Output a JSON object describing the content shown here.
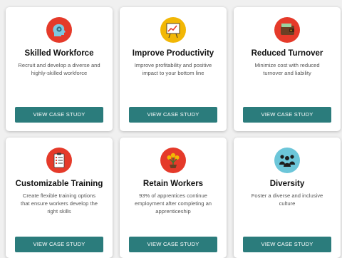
{
  "colors": {
    "button_bg": "#2b7c7c",
    "button_text": "#ffffff",
    "icon_red": "#e53a2a",
    "icon_yellow": "#f2b705",
    "icon_teal": "#6cc6d9",
    "title_text": "#111111",
    "desc_text": "#555555"
  },
  "cards": [
    {
      "icon": "head-gear-icon",
      "title": "Skilled Workforce",
      "desc_lines": [
        "Recruit and develop a diverse and",
        "highly-skilled workforce"
      ],
      "button_label": "VIEW CASE STUDY"
    },
    {
      "icon": "chart-board-icon",
      "title": "Improve Productivity",
      "desc_lines": [
        "Improve profitability and positive",
        "impact to your bottom line"
      ],
      "button_label": "VIEW CASE STUDY"
    },
    {
      "icon": "wallet-icon",
      "title": "Reduced Turnover",
      "desc_lines": [
        "Minimize cost with reduced",
        "turnover and liability"
      ],
      "button_label": "VIEW CASE STUDY"
    },
    {
      "icon": "clipboard-icon",
      "title": "Customizable Training",
      "desc_lines": [
        "Create flexible training options",
        "that ensure workers develop the",
        "right skills"
      ],
      "button_label": "VIEW CASE STUDY"
    },
    {
      "icon": "money-plant-icon",
      "title": "Retain Workers",
      "desc_lines": [
        "93% of apprentices continue",
        "employment after completing an",
        "apprenticeship"
      ],
      "button_label": "VIEW CASE STUDY"
    },
    {
      "icon": "people-group-icon",
      "title": "Diversity",
      "desc_lines": [
        "Foster a diverse and inclusive",
        "culture"
      ],
      "button_label": "VIEW CASE STUDY"
    }
  ]
}
